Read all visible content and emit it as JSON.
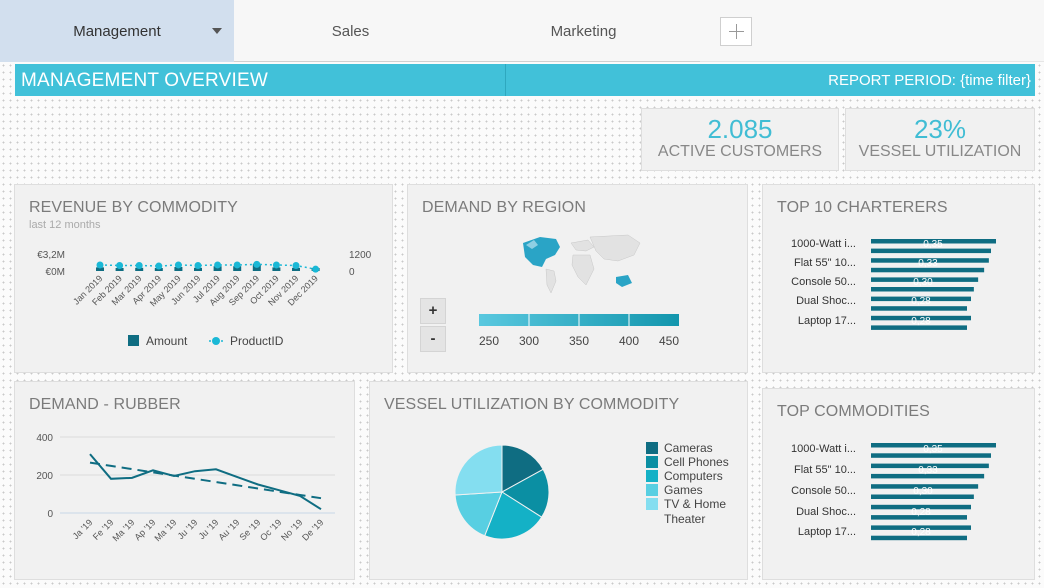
{
  "tabs": [
    {
      "label": "Management",
      "active": true
    },
    {
      "label": "Sales"
    },
    {
      "label": "Marketing"
    }
  ],
  "header": {
    "title": "MANAGEMENT OVERVIEW",
    "period": "REPORT PERIOD: {time filter}"
  },
  "kpis": [
    {
      "value": "2.085",
      "label": "ACTIVE CUSTOMERS"
    },
    {
      "value": "23%",
      "label": "VESSEL UTILIZATION"
    }
  ],
  "revenue": {
    "title": "REVENUE BY COMMODITY",
    "subtitle": "last 12 months",
    "left_ticks": [
      "€3,2M",
      "€0M"
    ],
    "right_ticks": [
      "1200",
      "0"
    ],
    "legend": [
      "Amount",
      "ProductID"
    ]
  },
  "region": {
    "title": "DEMAND BY REGION",
    "zoom_in": "+",
    "zoom_out": "-",
    "scale_labels": [
      "250",
      "300",
      "350",
      "400",
      "450"
    ]
  },
  "charterers": {
    "title": "TOP 10 CHARTERERS",
    "labels": [
      "1000-Watt i...",
      "Flat 55\" 10...",
      "Console 50...",
      "Dual Shoc...",
      "Laptop 17..."
    ],
    "overlays": [
      "0,35",
      "0,33",
      "0,30",
      "0,28",
      "0,28"
    ]
  },
  "rubber": {
    "title": "DEMAND - RUBBER",
    "y_ticks": [
      "400",
      "200",
      "0"
    ]
  },
  "vessel": {
    "title": "VESSEL UTILIZATION BY COMMODITY",
    "legend": [
      "Cameras",
      "Cell Phones",
      "Computers",
      "Games",
      "TV & Home",
      "Theater"
    ]
  },
  "commodities": {
    "title": "TOP COMMODITIES",
    "labels": [
      "1000-Watt i...",
      "Flat 55\" 10...",
      "Console 50...",
      "Dual Shoc...",
      "Laptop 17..."
    ],
    "overlays": [
      "0,35",
      "0,33",
      "0,30",
      "0,28",
      "0,28"
    ]
  },
  "colors": {
    "accent": "#41c1d9",
    "teal_dark": "#0f6d82",
    "teal": "#0b8fa3"
  },
  "chart_data": [
    {
      "type": "bar",
      "title": "REVENUE BY COMMODITY",
      "categories": [
        "Jan 2019",
        "Feb 2019",
        "Mar 2019",
        "Apr 2019",
        "May 2019",
        "Jun 2019",
        "Jul 2019",
        "Aug 2019",
        "Sep 2019",
        "Oct 2019",
        "Nov 2019",
        "Dec 2019"
      ],
      "series": [
        {
          "name": "Amount",
          "type": "bar",
          "values": [
            0.9,
            0.7,
            0.8,
            0.6,
            1.0,
            0.8,
            1.2,
            1.2,
            1.8,
            0.9,
            0.8,
            0.4
          ]
        },
        {
          "name": "ProductID",
          "type": "line",
          "values": [
            330,
            300,
            300,
            270,
            330,
            300,
            330,
            330,
            360,
            330,
            300,
            100
          ]
        }
      ],
      "ylim_left": [
        0,
        3.2
      ],
      "ylim_right": [
        0,
        1200
      ]
    },
    {
      "type": "line",
      "title": "DEMAND - RUBBER",
      "categories": [
        "Ja '19",
        "Fe '19",
        "Ma '19",
        "Ap '19",
        "Ma '19",
        "Ju '19",
        "Ju '19",
        "Au '19",
        "Se '19",
        "Oc '19",
        "No '19",
        "De '19"
      ],
      "series": [
        {
          "values": [
            310,
            180,
            185,
            225,
            195,
            220,
            230,
            190,
            150,
            120,
            90,
            20
          ]
        },
        {
          "values": [
            265,
            248,
            231,
            214,
            197,
            180,
            163,
            146,
            129,
            112,
            95,
            78
          ]
        }
      ],
      "ylim": [
        0,
        400
      ]
    },
    {
      "type": "pie",
      "title": "VESSEL UTILIZATION BY COMMODITY",
      "labels": [
        "Cameras",
        "Cell Phones",
        "Computers",
        "Games",
        "TV & Home Theater"
      ],
      "values": [
        17,
        17,
        22,
        18,
        26
      ]
    },
    {
      "type": "bar",
      "title": "TOP 10 CHARTERERS",
      "categories": [
        "1000-Watt i...",
        "Flat 55\" 10...",
        "Console 50...",
        "Dual Shoc...",
        "Laptop 17..."
      ],
      "values": [
        0.35,
        0.33,
        0.3,
        0.28,
        0.28
      ]
    },
    {
      "type": "bar",
      "title": "TOP COMMODITIES",
      "categories": [
        "1000-Watt i...",
        "Flat 55\" 10...",
        "Console 50...",
        "Dual Shoc...",
        "Laptop 17..."
      ],
      "values": [
        0.35,
        0.33,
        0.3,
        0.28,
        0.28
      ]
    }
  ]
}
